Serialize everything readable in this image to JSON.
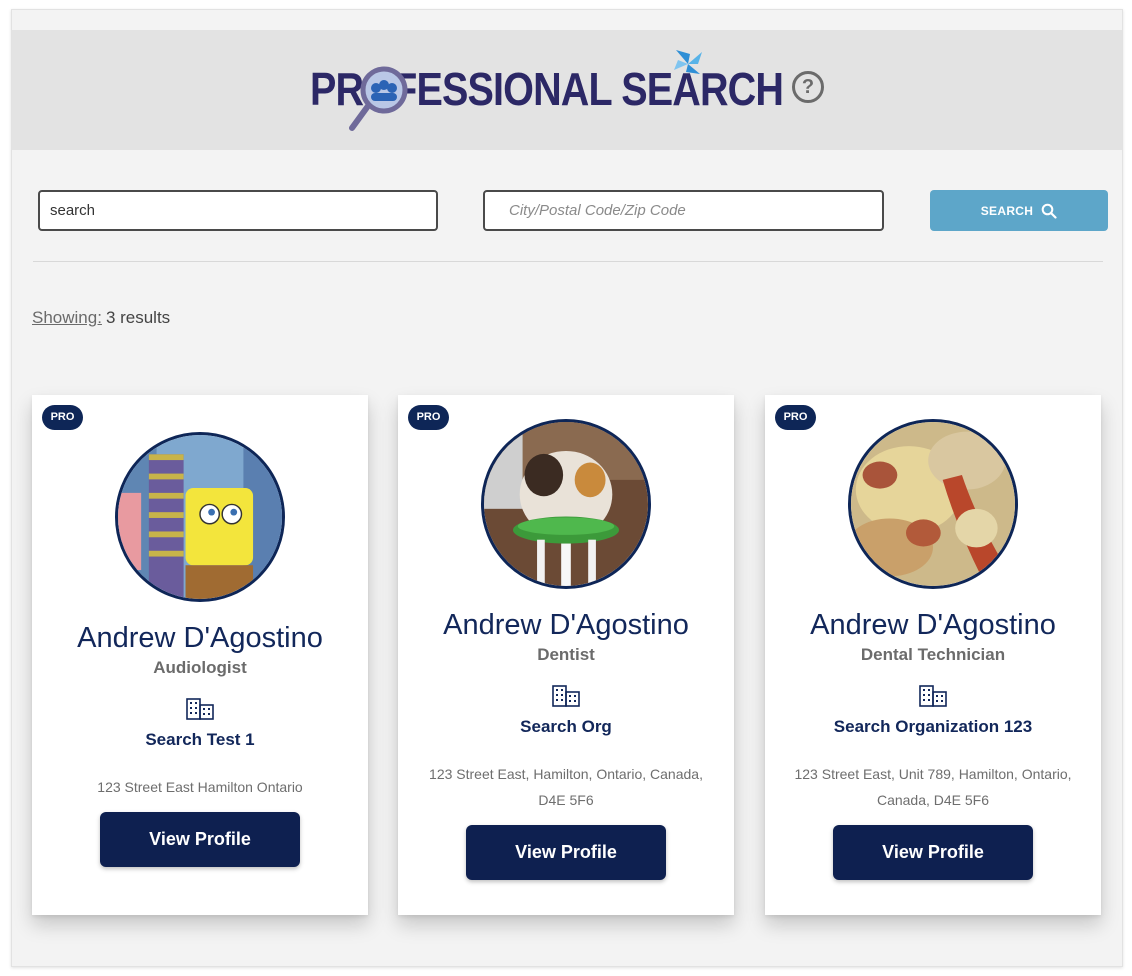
{
  "header": {
    "logo_text": "PROFESSIONAL SEARCH",
    "help_label": "?"
  },
  "search": {
    "keyword_value": "search",
    "location_placeholder": "City/Postal Code/Zip Code",
    "button_label": "SEARCH",
    "button_icon": "search-icon"
  },
  "results": {
    "showing_label": "Showing:",
    "count_text": "3 results"
  },
  "colors": {
    "navy": "#0e2050",
    "name_text": "#12275a",
    "search_button": "#5da6c9",
    "header_bg": "#e3e3e3"
  },
  "cards": [
    {
      "badge": "PRO",
      "name": "Andrew D'Agostino",
      "title": "Audiologist",
      "org_icon": "building-icon",
      "org": "Search Test 1",
      "address": "123 Street East Hamilton Ontario",
      "button": "View Profile"
    },
    {
      "badge": "PRO",
      "name": "Andrew D'Agostino",
      "title": "Dentist",
      "org_icon": "building-icon",
      "org": "Search Org",
      "address": "123 Street East, Hamilton, Ontario, Canada, D4E 5F6",
      "button": "View Profile"
    },
    {
      "badge": "PRO",
      "name": "Andrew D'Agostino",
      "title": "Dental Technician",
      "org_icon": "building-icon",
      "org": "Search Organization 123",
      "address": "123 Street East, Unit 789, Hamilton, Ontario, Canada, D4E 5F6",
      "button": "View Profile"
    }
  ]
}
